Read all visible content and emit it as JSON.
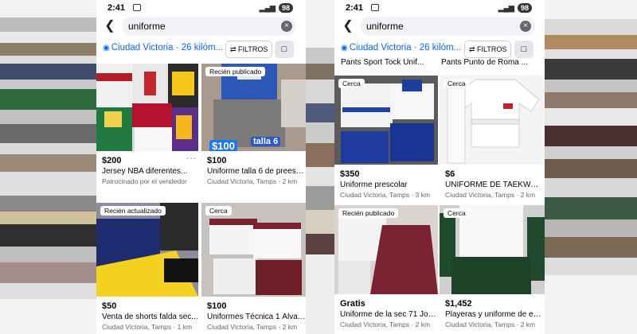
{
  "colors": {
    "accent": "#0866ff",
    "secondary_text": "#65676b",
    "badge_blue": "#1877f2"
  },
  "status": {
    "time": "2:41",
    "battery": "98"
  },
  "search": {
    "query": "uniforme"
  },
  "location": {
    "label": "Ciudad Victoria · 26 kilóm..."
  },
  "filters_label": "FILTROS",
  "left_screen": {
    "items": [
      {
        "badge": "",
        "price": "$200",
        "title": "Jersey NBA diferentes...",
        "subtitle": "Patrocinado por el vendedor",
        "image": "nba-jerseys"
      },
      {
        "badge": "Recién publicado",
        "price": "$100",
        "title": "Uniforme talla 6 de preesc...",
        "subtitle": "Ciudad Victoria, Tamps · 2 km",
        "image": "school-uniform-blue",
        "overlay_price": "$100",
        "overlay_size": "talla 6"
      },
      {
        "badge": "Recién actualizado",
        "price": "$50",
        "title": "Venta de shorts falda sec...",
        "subtitle": "Ciudad Victoria, Tamps · 1 km",
        "image": "yellow-black-uniform"
      },
      {
        "badge": "Cerca",
        "price": "$100",
        "title": "Uniformes Técnica 1 Álvar...",
        "subtitle": "Ciudad Victoria, Tamps · 2 km",
        "image": "maroon-white-uniforms"
      }
    ]
  },
  "right_screen": {
    "top_partial_titles": [
      "Pants Sport Tock Unif...",
      "Pants Punto de Roma ..."
    ],
    "items": [
      {
        "badge": "Cerca",
        "price": "$350",
        "title": "Uniforme prescolar",
        "subtitle": "Ciudad Victoria, Tamps · 3 km",
        "image": "white-blue-prescolar"
      },
      {
        "badge": "Cerca",
        "price": "$6",
        "title": "UNIFORME DE TAEKWON...",
        "subtitle": "Ciudad Victoria, Tamps · 2 km",
        "image": "taekwondo-uniform"
      },
      {
        "badge": "Recién publicado",
        "price": "Gratis",
        "title": "Uniforme de la sec 71 Jos...",
        "subtitle": "Ciudad Victoria, Tamps · 2 km",
        "image": "maroon-school-uniform"
      },
      {
        "badge": "Cerca",
        "price": "$1,452",
        "title": "Playeras y uniforme de ed...",
        "subtitle": "Ciudad Victoria, Tamps · 2 km",
        "image": "white-green-uniform"
      }
    ]
  },
  "icons": [
    "back-arrow-icon",
    "clear-icon",
    "location-pin-icon",
    "filters-icon",
    "bookmark-icon",
    "more-icon"
  ]
}
